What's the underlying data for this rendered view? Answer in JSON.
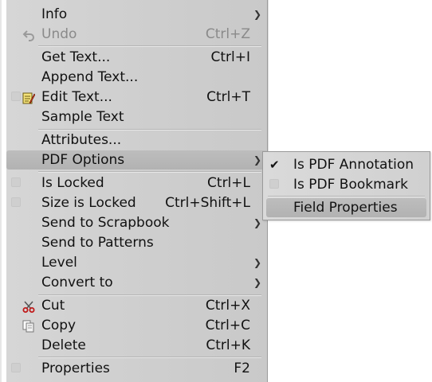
{
  "menu": {
    "info": "Info",
    "undo": "Undo",
    "undo_shortcut": "Ctrl+Z",
    "get_text": "Get Text...",
    "get_text_shortcut": "Ctrl+I",
    "append_text": "Append Text...",
    "edit_text": "Edit Text...",
    "edit_text_shortcut": "Ctrl+T",
    "sample_text": "Sample Text",
    "attributes": "Attributes...",
    "pdf_options": "PDF Options",
    "is_locked": "Is Locked",
    "is_locked_shortcut": "Ctrl+L",
    "size_is_locked": "Size is Locked",
    "size_is_locked_shortcut": "Ctrl+Shift+L",
    "send_to_scrapbook": "Send to Scrapbook",
    "send_to_patterns": "Send to Patterns",
    "level": "Level",
    "convert_to": "Convert to",
    "cut": "Cut",
    "cut_shortcut": "Ctrl+X",
    "copy": "Copy",
    "copy_shortcut": "Ctrl+C",
    "delete": "Delete",
    "delete_shortcut": "Ctrl+K",
    "properties": "Properties",
    "properties_shortcut": "F2"
  },
  "submenu": {
    "is_pdf_annotation": "Is PDF Annotation",
    "is_pdf_bookmark": "Is PDF Bookmark",
    "field_properties": "Field Properties"
  },
  "colors": {
    "menu_bg": "#d0d0d0",
    "highlight": "#b8b8b8",
    "disabled_text": "#8a8a8a"
  }
}
